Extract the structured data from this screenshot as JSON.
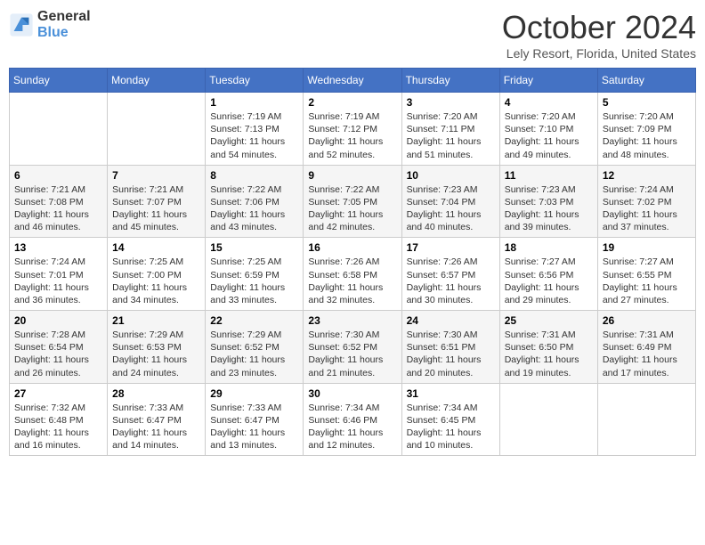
{
  "logo": {
    "line1": "General",
    "line2": "Blue"
  },
  "title": "October 2024",
  "location": "Lely Resort, Florida, United States",
  "days_of_week": [
    "Sunday",
    "Monday",
    "Tuesday",
    "Wednesday",
    "Thursday",
    "Friday",
    "Saturday"
  ],
  "weeks": [
    [
      {
        "day": "",
        "info": ""
      },
      {
        "day": "",
        "info": ""
      },
      {
        "day": "1",
        "info": "Sunrise: 7:19 AM\nSunset: 7:13 PM\nDaylight: 11 hours and 54 minutes."
      },
      {
        "day": "2",
        "info": "Sunrise: 7:19 AM\nSunset: 7:12 PM\nDaylight: 11 hours and 52 minutes."
      },
      {
        "day": "3",
        "info": "Sunrise: 7:20 AM\nSunset: 7:11 PM\nDaylight: 11 hours and 51 minutes."
      },
      {
        "day": "4",
        "info": "Sunrise: 7:20 AM\nSunset: 7:10 PM\nDaylight: 11 hours and 49 minutes."
      },
      {
        "day": "5",
        "info": "Sunrise: 7:20 AM\nSunset: 7:09 PM\nDaylight: 11 hours and 48 minutes."
      }
    ],
    [
      {
        "day": "6",
        "info": "Sunrise: 7:21 AM\nSunset: 7:08 PM\nDaylight: 11 hours and 46 minutes."
      },
      {
        "day": "7",
        "info": "Sunrise: 7:21 AM\nSunset: 7:07 PM\nDaylight: 11 hours and 45 minutes."
      },
      {
        "day": "8",
        "info": "Sunrise: 7:22 AM\nSunset: 7:06 PM\nDaylight: 11 hours and 43 minutes."
      },
      {
        "day": "9",
        "info": "Sunrise: 7:22 AM\nSunset: 7:05 PM\nDaylight: 11 hours and 42 minutes."
      },
      {
        "day": "10",
        "info": "Sunrise: 7:23 AM\nSunset: 7:04 PM\nDaylight: 11 hours and 40 minutes."
      },
      {
        "day": "11",
        "info": "Sunrise: 7:23 AM\nSunset: 7:03 PM\nDaylight: 11 hours and 39 minutes."
      },
      {
        "day": "12",
        "info": "Sunrise: 7:24 AM\nSunset: 7:02 PM\nDaylight: 11 hours and 37 minutes."
      }
    ],
    [
      {
        "day": "13",
        "info": "Sunrise: 7:24 AM\nSunset: 7:01 PM\nDaylight: 11 hours and 36 minutes."
      },
      {
        "day": "14",
        "info": "Sunrise: 7:25 AM\nSunset: 7:00 PM\nDaylight: 11 hours and 34 minutes."
      },
      {
        "day": "15",
        "info": "Sunrise: 7:25 AM\nSunset: 6:59 PM\nDaylight: 11 hours and 33 minutes."
      },
      {
        "day": "16",
        "info": "Sunrise: 7:26 AM\nSunset: 6:58 PM\nDaylight: 11 hours and 32 minutes."
      },
      {
        "day": "17",
        "info": "Sunrise: 7:26 AM\nSunset: 6:57 PM\nDaylight: 11 hours and 30 minutes."
      },
      {
        "day": "18",
        "info": "Sunrise: 7:27 AM\nSunset: 6:56 PM\nDaylight: 11 hours and 29 minutes."
      },
      {
        "day": "19",
        "info": "Sunrise: 7:27 AM\nSunset: 6:55 PM\nDaylight: 11 hours and 27 minutes."
      }
    ],
    [
      {
        "day": "20",
        "info": "Sunrise: 7:28 AM\nSunset: 6:54 PM\nDaylight: 11 hours and 26 minutes."
      },
      {
        "day": "21",
        "info": "Sunrise: 7:29 AM\nSunset: 6:53 PM\nDaylight: 11 hours and 24 minutes."
      },
      {
        "day": "22",
        "info": "Sunrise: 7:29 AM\nSunset: 6:52 PM\nDaylight: 11 hours and 23 minutes."
      },
      {
        "day": "23",
        "info": "Sunrise: 7:30 AM\nSunset: 6:52 PM\nDaylight: 11 hours and 21 minutes."
      },
      {
        "day": "24",
        "info": "Sunrise: 7:30 AM\nSunset: 6:51 PM\nDaylight: 11 hours and 20 minutes."
      },
      {
        "day": "25",
        "info": "Sunrise: 7:31 AM\nSunset: 6:50 PM\nDaylight: 11 hours and 19 minutes."
      },
      {
        "day": "26",
        "info": "Sunrise: 7:31 AM\nSunset: 6:49 PM\nDaylight: 11 hours and 17 minutes."
      }
    ],
    [
      {
        "day": "27",
        "info": "Sunrise: 7:32 AM\nSunset: 6:48 PM\nDaylight: 11 hours and 16 minutes."
      },
      {
        "day": "28",
        "info": "Sunrise: 7:33 AM\nSunset: 6:47 PM\nDaylight: 11 hours and 14 minutes."
      },
      {
        "day": "29",
        "info": "Sunrise: 7:33 AM\nSunset: 6:47 PM\nDaylight: 11 hours and 13 minutes."
      },
      {
        "day": "30",
        "info": "Sunrise: 7:34 AM\nSunset: 6:46 PM\nDaylight: 11 hours and 12 minutes."
      },
      {
        "day": "31",
        "info": "Sunrise: 7:34 AM\nSunset: 6:45 PM\nDaylight: 11 hours and 10 minutes."
      },
      {
        "day": "",
        "info": ""
      },
      {
        "day": "",
        "info": ""
      }
    ]
  ]
}
